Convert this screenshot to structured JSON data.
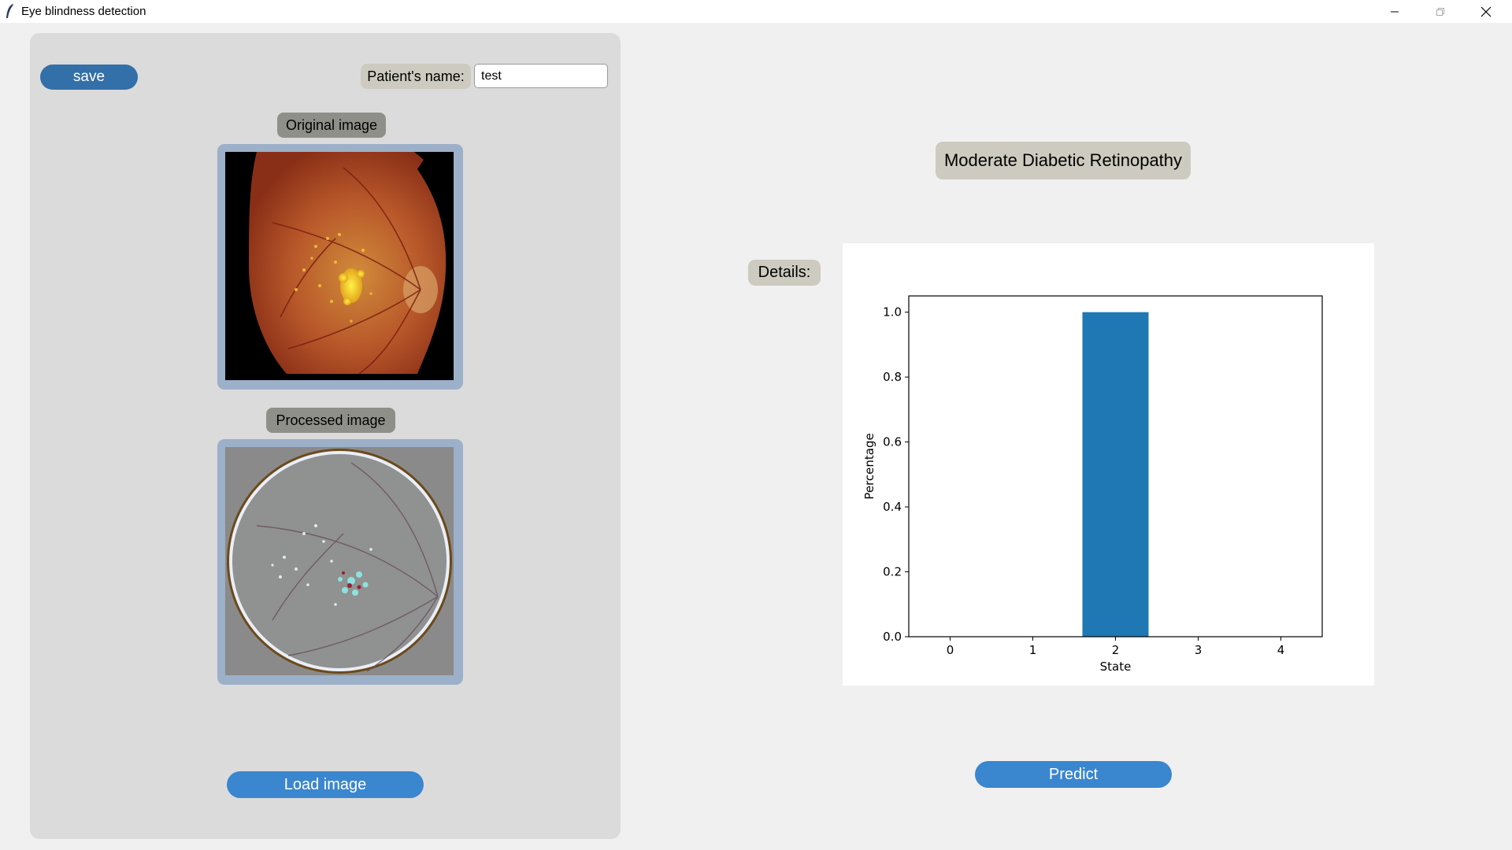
{
  "window": {
    "title": "Eye blindness detection",
    "controls": {
      "minimize_icon": "minimize-icon",
      "maximize_icon": "maximize-icon",
      "close_icon": "close-icon"
    }
  },
  "left_panel": {
    "save_label": "save",
    "patient_label": "Patient's name:",
    "patient_value": "test",
    "original_label": "Original image",
    "processed_label": "Processed image",
    "load_label": "Load image"
  },
  "right_panel": {
    "result": "Moderate Diabetic Retinopathy",
    "details_label": "Details:",
    "predict_label": "Predict"
  },
  "colors": {
    "save_button": "#336fa8",
    "action_button": "#3a86cf",
    "chip": "#cdcbbf",
    "dark_chip": "#8f8f8a",
    "image_frame": "#9cb0c9",
    "bar": "#1f77b4"
  },
  "chart_data": {
    "type": "bar",
    "categories": [
      "0",
      "1",
      "2",
      "3",
      "4"
    ],
    "values": [
      0,
      0,
      1.0,
      0,
      0
    ],
    "xlabel": "State",
    "ylabel": "Percentage",
    "ylim": [
      0,
      1.05
    ],
    "yticks": [
      "0.0",
      "0.2",
      "0.4",
      "0.6",
      "0.8",
      "1.0"
    ],
    "grid": false
  }
}
